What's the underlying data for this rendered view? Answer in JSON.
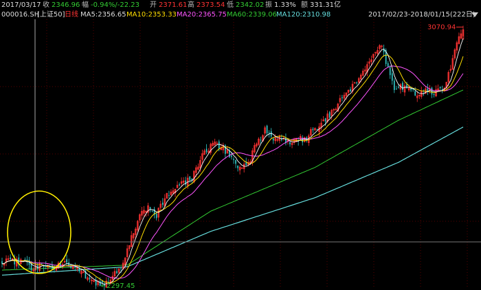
{
  "header": {
    "date": "2017/03/17",
    "close_label": "收",
    "close_value": "2346.96",
    "change_label": "幅",
    "change_value": "-0.94%/-22.23",
    "open_label": "开",
    "open_value": "2371.61",
    "high_label": "高",
    "high_value": "2373.54",
    "low_label": "低",
    "low_value": "2342.02",
    "amplitude_label": "振",
    "amplitude_value": "1.33%",
    "amount_label": "额",
    "amount_value": "331.31亿"
  },
  "indicator": {
    "code": "000016.SH",
    "name": "[上证50]",
    "period": "日线",
    "ma5": "MA5:2356.65",
    "ma10": "MA10:2353.33",
    "ma20": "MA20:2365.75",
    "ma60": "MA60:2339.06",
    "ma120": "MA120:2310.98",
    "range": "2017/02/23-2018/01/15(222日)"
  },
  "annotations": {
    "max_label": "3070.94",
    "min_label": "2297.45"
  },
  "colors": {
    "up": "#ff3333",
    "down": "#33cccc",
    "ma5": "#ffffff",
    "ma10": "#ffdd00",
    "ma20": "#ff55ff",
    "ma60": "#33cc33",
    "ma120": "#66dddd",
    "highlight_ellipse": "#ffee00"
  },
  "chart_data": {
    "type": "candlestick",
    "x_start": "2017/02/23",
    "x_end": "2018/01/15",
    "bar_count": 222,
    "ylim": [
      2290,
      3090
    ],
    "grid": true,
    "highlight": "ellipse around early sideways period",
    "anchors": [
      [
        0,
        2372
      ],
      [
        10,
        2366
      ],
      [
        15,
        2352
      ],
      [
        20,
        2358
      ],
      [
        25,
        2355
      ],
      [
        30,
        2370
      ],
      [
        35,
        2345
      ],
      [
        40,
        2330
      ],
      [
        45,
        2310
      ],
      [
        48,
        2297
      ],
      [
        52,
        2320
      ],
      [
        58,
        2362
      ],
      [
        62,
        2445
      ],
      [
        66,
        2500
      ],
      [
        70,
        2540
      ],
      [
        74,
        2510
      ],
      [
        78,
        2560
      ],
      [
        82,
        2580
      ],
      [
        86,
        2600
      ],
      [
        90,
        2610
      ],
      [
        94,
        2660
      ],
      [
        98,
        2700
      ],
      [
        102,
        2720
      ],
      [
        106,
        2705
      ],
      [
        110,
        2680
      ],
      [
        114,
        2640
      ],
      [
        118,
        2660
      ],
      [
        122,
        2720
      ],
      [
        126,
        2760
      ],
      [
        130,
        2740
      ],
      [
        134,
        2730
      ],
      [
        138,
        2725
      ],
      [
        142,
        2730
      ],
      [
        146,
        2740
      ],
      [
        150,
        2765
      ],
      [
        154,
        2790
      ],
      [
        158,
        2815
      ],
      [
        162,
        2850
      ],
      [
        166,
        2870
      ],
      [
        170,
        2905
      ],
      [
        174,
        2940
      ],
      [
        178,
        2980
      ],
      [
        182,
        3010
      ],
      [
        185,
        2940
      ],
      [
        188,
        2890
      ],
      [
        192,
        2885
      ],
      [
        196,
        2875
      ],
      [
        200,
        2865
      ],
      [
        204,
        2880
      ],
      [
        208,
        2870
      ],
      [
        212,
        2895
      ],
      [
        216,
        2970
      ],
      [
        219,
        3030
      ],
      [
        221,
        3070
      ]
    ],
    "ma60_anchors": [
      [
        0,
        2345
      ],
      [
        60,
        2360
      ],
      [
        100,
        2520
      ],
      [
        150,
        2650
      ],
      [
        190,
        2790
      ],
      [
        221,
        2880
      ]
    ],
    "ma120_anchors": [
      [
        0,
        2330
      ],
      [
        60,
        2355
      ],
      [
        100,
        2460
      ],
      [
        150,
        2560
      ],
      [
        190,
        2665
      ],
      [
        221,
        2770
      ]
    ],
    "max": {
      "index": 221,
      "value": 3070.94
    },
    "min": {
      "index": 48,
      "value": 2297.45
    }
  }
}
